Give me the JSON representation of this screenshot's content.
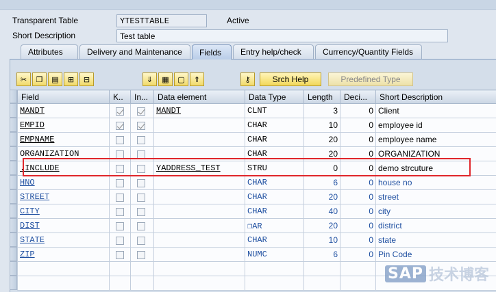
{
  "header": {
    "transparent_table_label": "Transparent Table",
    "table_name": "YTESTTABLE",
    "status": "Active",
    "short_desc_label": "Short Description",
    "short_desc_value": "Test table"
  },
  "tabs": [
    {
      "label": "Attributes",
      "active": false
    },
    {
      "label": "Delivery and Maintenance",
      "active": false
    },
    {
      "label": "Fields",
      "active": true
    },
    {
      "label": "Entry help/check",
      "active": false
    },
    {
      "label": "Currency/Quantity Fields",
      "active": false
    }
  ],
  "toolbar": {
    "icons": [
      "cut-icon",
      "copy-icon",
      "paste-icon",
      "insert-row-icon",
      "delete-row-icon",
      "sort-icon",
      "select-all-icon",
      "deselect-icon",
      "up-icon",
      "key-icon"
    ],
    "srch_help_label": "Srch Help",
    "predefined_type_label": "Predefined Type"
  },
  "columns": [
    "Field",
    "K..",
    "In...",
    "Data element",
    "Data Type",
    "Length",
    "Deci...",
    "Short Description"
  ],
  "rows": [
    {
      "field": "MANDT",
      "key": true,
      "init": true,
      "data_element": "MANDT",
      "data_type": "CLNT",
      "length": "3",
      "decimals": "0",
      "desc": "Client",
      "style": "normal"
    },
    {
      "field": "EMPID",
      "key": true,
      "init": true,
      "data_element": "",
      "data_type": "CHAR",
      "length": "10",
      "decimals": "0",
      "desc": "employee id",
      "style": "normal"
    },
    {
      "field": "EMPNAME",
      "key": false,
      "init": false,
      "data_element": "",
      "data_type": "CHAR",
      "length": "20",
      "decimals": "0",
      "desc": "employee name",
      "style": "normal"
    },
    {
      "field": "ORGANIZATION",
      "key": false,
      "init": false,
      "data_element": "",
      "data_type": "CHAR",
      "length": "20",
      "decimals": "0",
      "desc": "ORGANIZATION",
      "style": "normal"
    },
    {
      "field": ".INCLUDE",
      "key": false,
      "init": false,
      "data_element": "YADDRESS_TEST",
      "data_type": "STRU",
      "length": "0",
      "decimals": "0",
      "desc": "demo strcuture",
      "style": "include"
    },
    {
      "field": "HNO",
      "key": false,
      "init": false,
      "data_element": "",
      "data_type": "CHAR",
      "length": "6",
      "decimals": "0",
      "desc": "house no",
      "style": "blue"
    },
    {
      "field": "STREET",
      "key": false,
      "init": false,
      "data_element": "",
      "data_type": "CHAR",
      "length": "20",
      "decimals": "0",
      "desc": "street",
      "style": "blue"
    },
    {
      "field": "CITY",
      "key": false,
      "init": false,
      "data_element": "",
      "data_type": "CHAR",
      "length": "40",
      "decimals": "0",
      "desc": "city",
      "style": "blue"
    },
    {
      "field": "DIST",
      "key": false,
      "init": false,
      "data_element": "",
      "data_type": "AR",
      "length": "20",
      "decimals": "0",
      "desc": "district",
      "style": "blue"
    },
    {
      "field": "STATE",
      "key": false,
      "init": false,
      "data_element": "",
      "data_type": "CHAR",
      "length": "10",
      "decimals": "0",
      "desc": "state",
      "style": "blue"
    },
    {
      "field": "ZIP",
      "key": false,
      "init": false,
      "data_element": "",
      "data_type": "NUMC",
      "length": "6",
      "decimals": "0",
      "desc": "Pin Code",
      "style": "blue"
    }
  ],
  "watermark": {
    "logo": "SAP",
    "text": "技术博客"
  },
  "colors": {
    "highlight_box": "#e0262b",
    "include_component_text": "#1d4ea0"
  }
}
